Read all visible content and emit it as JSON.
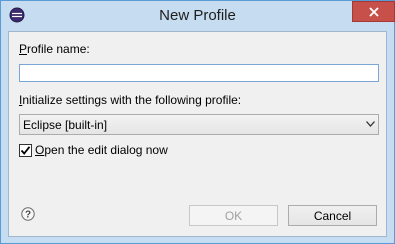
{
  "window": {
    "title": "New Profile",
    "accent": "#c6dcf0",
    "close_color": "#c7504a"
  },
  "form": {
    "profile_name": {
      "label_accel": "P",
      "label_rest": "rofile name:",
      "value": ""
    },
    "init_settings": {
      "label_accel": "I",
      "label_rest": "nitialize settings with the following profile:",
      "selected": "Eclipse [built-in]"
    },
    "open_edit": {
      "label_accel": "O",
      "label_rest": "pen the edit dialog now",
      "checked": true
    }
  },
  "buttons": {
    "ok_label": "OK",
    "cancel_label": "Cancel"
  },
  "icons": {
    "app": "eclipse-icon",
    "help": "help-icon",
    "close": "close-icon",
    "dropdown": "chevron-down-icon",
    "check": "checkmark-icon"
  }
}
